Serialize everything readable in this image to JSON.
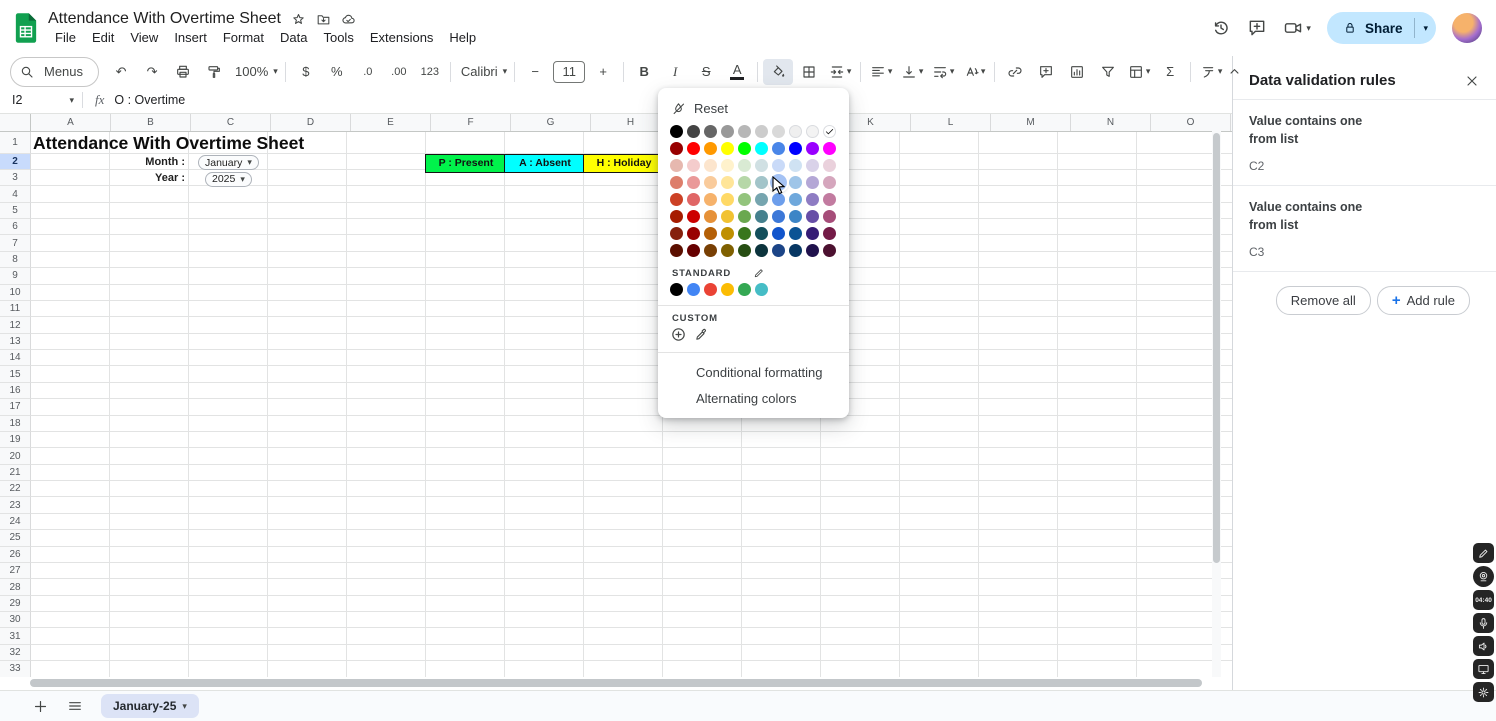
{
  "titlebar": {
    "doc_title": "Attendance With Overtime Sheet",
    "menu_items": [
      "File",
      "Edit",
      "View",
      "Insert",
      "Format",
      "Data",
      "Tools",
      "Extensions",
      "Help"
    ],
    "share_label": "Share"
  },
  "toolbar": {
    "items": [
      {
        "name": "menus",
        "icon": "search",
        "label": "Menus",
        "pill": true
      },
      {
        "name": "undo",
        "glyph": "↶"
      },
      {
        "name": "redo",
        "glyph": "↷"
      },
      {
        "name": "print",
        "icon": "print"
      },
      {
        "name": "paint-format",
        "icon": "paint"
      },
      {
        "name": "zoom",
        "label": "100%",
        "dropdown": true
      },
      {
        "sep": true
      },
      {
        "name": "format-currency",
        "glyph": "$"
      },
      {
        "name": "format-percent",
        "glyph": "%"
      },
      {
        "name": "decrease-decimal",
        "glyph": ".0",
        "small": true
      },
      {
        "name": "increase-decimal",
        "glyph": ".00",
        "small": true
      },
      {
        "name": "more-formats",
        "glyph": "123",
        "small": true
      },
      {
        "sep": true
      },
      {
        "name": "font",
        "label": "Calibri",
        "dropdown": true
      },
      {
        "sep": true
      },
      {
        "name": "decrease-font-size",
        "glyph": "−"
      },
      {
        "name": "font-size",
        "label": "11",
        "boxed": true
      },
      {
        "name": "increase-font-size",
        "glyph": "+"
      },
      {
        "sep": true
      },
      {
        "name": "bold",
        "glyph": "B",
        "bold": true
      },
      {
        "name": "italic",
        "glyph": "I",
        "italic": true
      },
      {
        "name": "strikethrough",
        "glyph": "S",
        "strike": true
      },
      {
        "name": "text-color",
        "glyph": "A",
        "colorbar": "#202124"
      },
      {
        "sep": true
      },
      {
        "name": "fill-color",
        "icon": "fill",
        "active": true
      },
      {
        "name": "borders",
        "icon": "borders"
      },
      {
        "name": "merge-cells",
        "icon": "merge",
        "dropdown": true
      },
      {
        "sep": true
      },
      {
        "name": "horizontal-align",
        "icon": "halign",
        "dropdown": true
      },
      {
        "name": "vertical-align",
        "icon": "valign",
        "dropdown": true
      },
      {
        "name": "text-wrapping",
        "icon": "wrap",
        "dropdown": true
      },
      {
        "name": "text-rotation",
        "icon": "rotate",
        "dropdown": true
      },
      {
        "sep": true
      },
      {
        "name": "insert-link",
        "icon": "link"
      },
      {
        "name": "insert-comment",
        "icon": "comment"
      },
      {
        "name": "insert-chart",
        "icon": "chart"
      },
      {
        "name": "create-filter",
        "icon": "filter"
      },
      {
        "name": "table-views",
        "icon": "tableviews",
        "dropdown": true
      },
      {
        "name": "functions",
        "glyph": "Σ"
      },
      {
        "sep": true
      },
      {
        "name": "input-tools",
        "icon": "inputtools",
        "dropdown": true
      }
    ]
  },
  "formula_bar": {
    "cell_ref": "I2",
    "fx_label": "fx",
    "value": "O : Overtime"
  },
  "grid": {
    "columns": [
      "A",
      "B",
      "C",
      "D",
      "E",
      "F",
      "G",
      "H",
      "I",
      "J",
      "K",
      "L",
      "M",
      "N",
      "O"
    ],
    "row_count": 33,
    "selected_row": 2,
    "cells": {
      "title": "Attendance With Overtime Sheet",
      "month_label": "Month :",
      "month_value": "January",
      "year_label": "Year :",
      "year_value": "2025"
    },
    "legend": [
      {
        "label": "P : Present",
        "color": "#00f24b"
      },
      {
        "label": "A : Absent",
        "color": "#00ffff"
      },
      {
        "label": "H : Holiday",
        "color": "#ffff00"
      }
    ]
  },
  "color_picker": {
    "reset_label": "Reset",
    "palette": [
      [
        "#000000",
        "#434343",
        "#666666",
        "#999999",
        "#b7b7b7",
        "#cccccc",
        "#d9d9d9",
        "#efefef",
        "#f3f3f3",
        "#ffffff"
      ],
      [
        "#980000",
        "#ff0000",
        "#ff9900",
        "#ffff00",
        "#00ff00",
        "#00ffff",
        "#4a86e8",
        "#0000ff",
        "#9900ff",
        "#ff00ff"
      ],
      [
        "#e6b8af",
        "#f4cccc",
        "#fce5cd",
        "#fff2cc",
        "#d9ead3",
        "#d0e0e3",
        "#c9daf8",
        "#cfe2f3",
        "#d9d2e9",
        "#ead1dc"
      ],
      [
        "#dd7e6b",
        "#ea9999",
        "#f9cb9c",
        "#ffe599",
        "#b6d7a8",
        "#a2c4c9",
        "#a4c2f4",
        "#9fc5e8",
        "#b4a7d6",
        "#d5a6bd"
      ],
      [
        "#cc4125",
        "#e06666",
        "#f6b26b",
        "#ffd966",
        "#93c47d",
        "#76a5af",
        "#6d9eeb",
        "#6fa8dc",
        "#8e7cc3",
        "#c27ba0"
      ],
      [
        "#a61c00",
        "#cc0000",
        "#e69138",
        "#f1c232",
        "#6aa84f",
        "#45818e",
        "#3c78d8",
        "#3d85c6",
        "#674ea7",
        "#a64d79"
      ],
      [
        "#85200c",
        "#990000",
        "#b45f06",
        "#bf9000",
        "#38761d",
        "#134f5c",
        "#1155cc",
        "#0b5394",
        "#351c75",
        "#741b47"
      ],
      [
        "#5b0f00",
        "#660000",
        "#783f04",
        "#7f6000",
        "#274e13",
        "#0c343d",
        "#1c4587",
        "#073763",
        "#20124d",
        "#4c1130"
      ]
    ],
    "selected_swatch": {
      "row": 0,
      "col": 9
    },
    "hover_swatch": {
      "row": 3,
      "col": 6
    },
    "standard_label": "STANDARD",
    "standard_colors": [
      "#000000",
      "#4285f4",
      "#ea4335",
      "#fbbc04",
      "#34a853",
      "#46bdc6"
    ],
    "custom_label": "CUSTOM",
    "items": [
      "Conditional formatting",
      "Alternating colors"
    ]
  },
  "panel": {
    "title": "Data validation rules",
    "rules": [
      {
        "text": "Value contains one from list",
        "range": "C2"
      },
      {
        "text": "Value contains one from list",
        "range": "C3"
      }
    ],
    "remove_all_label": "Remove all",
    "add_rule_label": "Add rule"
  },
  "tabs_bar": {
    "active_tab": "January-25"
  },
  "recorder": {
    "time": "04:40",
    "tools": [
      "pen",
      "webcam",
      "timer",
      "mic",
      "speaker",
      "monitor",
      "gear"
    ]
  }
}
